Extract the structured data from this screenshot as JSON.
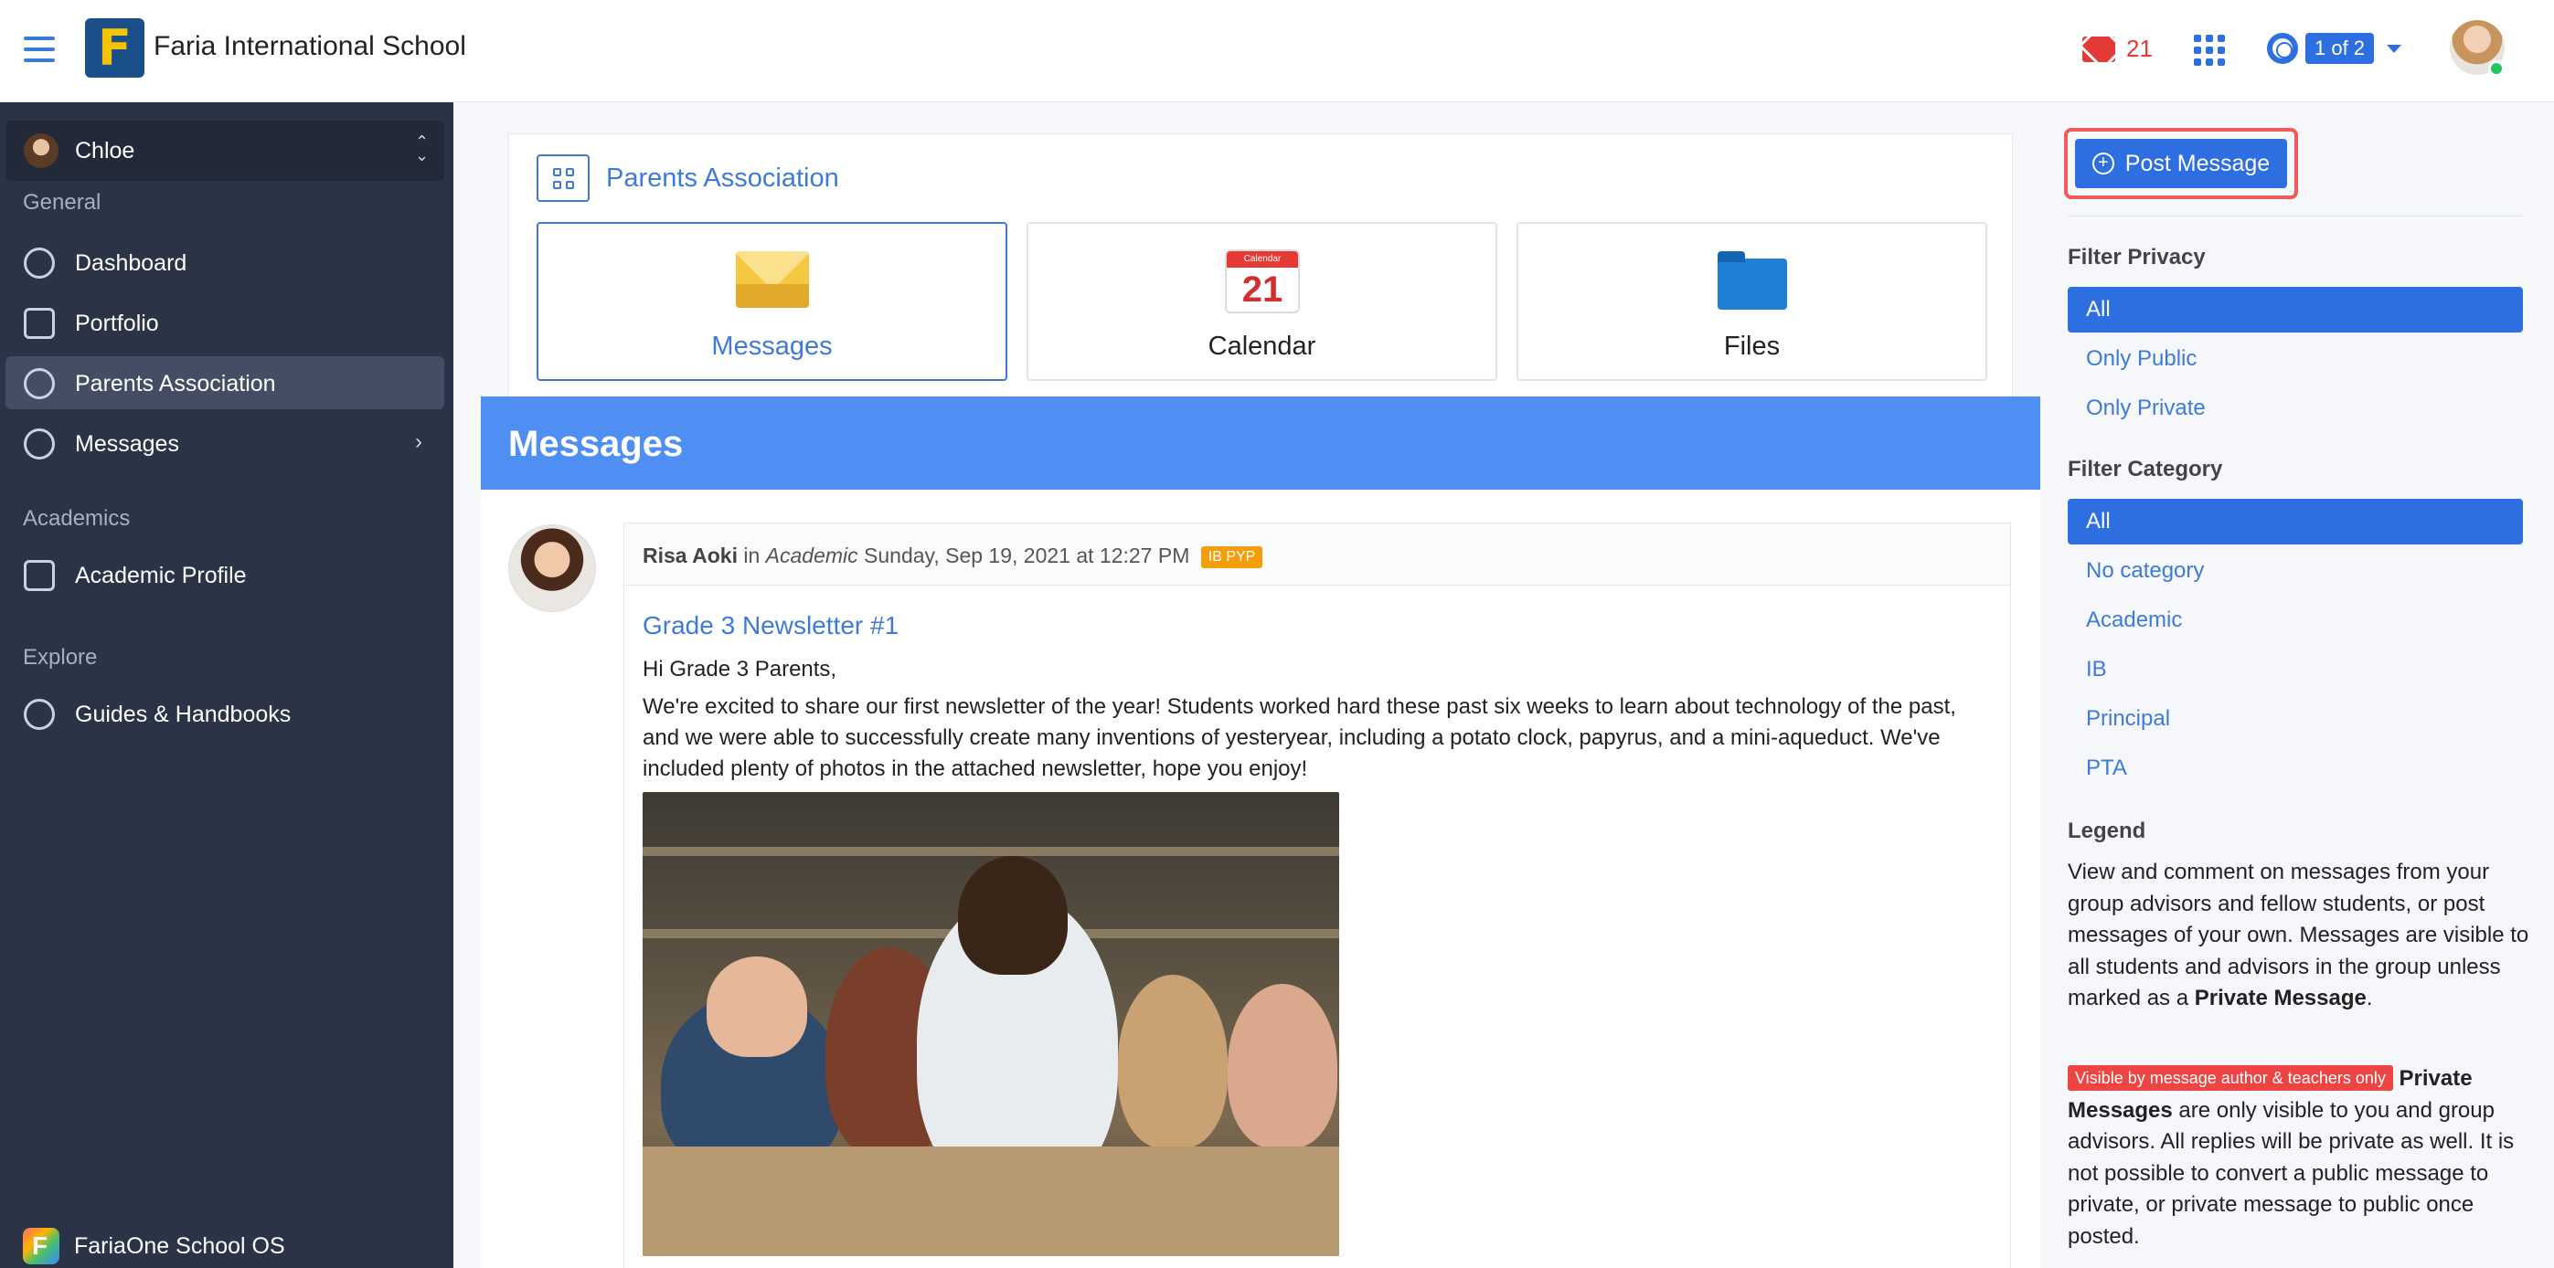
{
  "header": {
    "school_name": "Faria International School",
    "logo_letter": "F",
    "mail_count": "21",
    "pager": "1 of 2"
  },
  "sidebar": {
    "user_name": "Chloe",
    "sections": {
      "general": "General",
      "academics": "Academics",
      "explore": "Explore"
    },
    "items": [
      {
        "label": "Dashboard"
      },
      {
        "label": "Portfolio"
      },
      {
        "label": "Parents Association"
      },
      {
        "label": "Messages"
      },
      {
        "label": "Academic Profile"
      },
      {
        "label": "Guides & Handbooks"
      }
    ],
    "bottom_brand": "FariaOne School OS"
  },
  "group": {
    "title": "Parents Association",
    "tiles": [
      {
        "label": "Messages"
      },
      {
        "label": "Calendar"
      },
      {
        "label": "Files"
      }
    ],
    "calendar_header": "Calendar",
    "calendar_day": "21"
  },
  "messages": {
    "heading": "Messages",
    "post": {
      "author": "Risa Aoki",
      "in_word": "in",
      "category": "Academic",
      "datetime": "Sunday, Sep 19, 2021 at 12:27 PM",
      "badge": "IB PYP",
      "title": "Grade 3 Newsletter #1",
      "greeting": "Hi Grade 3 Parents,",
      "body": "We're excited to share our first newsletter of the year! Students worked hard these past six weeks to learn about technology of the past, and we were able to successfully create many inventions of yesteryear, including a potato clock, papyrus, and a mini-aqueduct. We've included plenty of photos in the attached newsletter, hope you enjoy!"
    }
  },
  "right_panel": {
    "post_button": "Post Message",
    "filter_privacy": {
      "heading": "Filter Privacy",
      "options": [
        "All",
        "Only Public",
        "Only Private"
      ],
      "selected": "All"
    },
    "filter_category": {
      "heading": "Filter Category",
      "options": [
        "All",
        "No category",
        "Academic",
        "IB",
        "Principal",
        "PTA"
      ],
      "selected": "All"
    },
    "legend": {
      "heading": "Legend",
      "para1_text": "View and comment on messages from your group advisors and fellow students, or post messages of your own. Messages are visible to all students and advisors in the group unless marked as a",
      "para1_bold": "Private Message",
      "para1_end": ".",
      "private_badge": "Visible by message author & teachers only",
      "para2_bold": "Private Messages",
      "para2_text": "are only visible to you and group advisors. All replies will be private as well. It is not possible to convert a public message to private, or private message to public once posted."
    }
  },
  "colors": {
    "accent": "#2d6fe0",
    "sidebar_bg": "#2b3447",
    "messages_header": "#4f8ef2",
    "alert": "#e53935",
    "badge_ib": "#f59e0b"
  }
}
